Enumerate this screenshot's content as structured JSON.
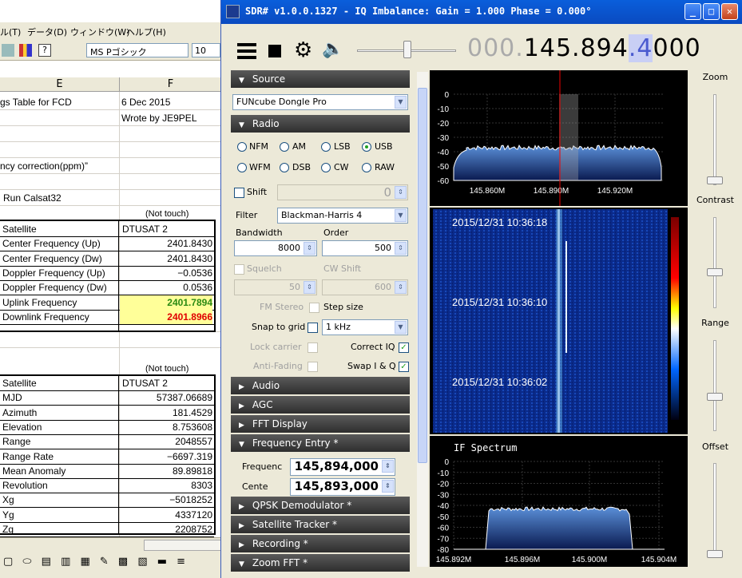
{
  "excel": {
    "menu": [
      "ル(T)",
      "データ(D)",
      "ウィンドウ(W)",
      "ヘルプ(H)"
    ],
    "font": "MS Pゴシック",
    "size": "10",
    "cols": [
      "E",
      "F"
    ],
    "r1": [
      "gs Table for FCD",
      "6 Dec 2015"
    ],
    "r2": "Wrote by JE9PEL",
    "r3": "ncy correction(ppm)”",
    "r4": "Run Calsat32",
    "nt1": "(Not touch)",
    "t1": [
      [
        "Satellite",
        "DTUSAT 2"
      ],
      [
        "Center Frequency (Up)",
        "2401.8430"
      ],
      [
        "Center Frequency (Dw)",
        "2401.8430"
      ],
      [
        "Doppler Frequency (Up)",
        "−0.0536"
      ],
      [
        "Doppler Frequency (Dw)",
        "0.0536"
      ],
      [
        "Uplink Frequency",
        "2401.7894"
      ],
      [
        "Downlink Frequency",
        "2401.8966"
      ]
    ],
    "nt2": "(Not touch)",
    "t2": [
      [
        "Satellite",
        "DTUSAT 2"
      ],
      [
        "MJD",
        "57387.06689"
      ],
      [
        "Azimuth",
        "181.4529"
      ],
      [
        "Elevation",
        "8.753608"
      ],
      [
        "Range",
        "2048557"
      ],
      [
        "Range Rate",
        "−6697.319"
      ],
      [
        "Mean Anomaly",
        "89.89818"
      ],
      [
        "Revolution",
        "8303"
      ],
      [
        "Xg",
        "−5018252"
      ],
      [
        "Yg",
        "4337120"
      ],
      [
        "Zg",
        "2208752"
      ]
    ]
  },
  "sdr": {
    "title": "SDR# v1.0.0.1327 - IQ Imbalance: Gain = 1.000 Phase = 0.000°",
    "freq_gray": "000.",
    "freq_main": "145.894",
    "freq_sel": ".4",
    "freq_end": "000",
    "source_hdr": "Source",
    "source_dev": "FUNcube Dongle Pro",
    "radio_hdr": "Radio",
    "modes": [
      "NFM",
      "AM",
      "LSB",
      "USB",
      "WFM",
      "DSB",
      "CW",
      "RAW"
    ],
    "shift": "Shift",
    "shift_val": "0",
    "filter_lbl": "Filter",
    "filter": "Blackman-Harris 4",
    "bw_lbl": "Bandwidth",
    "order_lbl": "Order",
    "bw": "8000",
    "order": "500",
    "squelch": "Squelch",
    "cwshift": "CW Shift",
    "sq_val": "50",
    "cw_val": "600",
    "fmstereo": "FM Stereo",
    "stepsize": "Step size",
    "snap": "Snap to grid",
    "step": "1 kHz",
    "lockc": "Lock carrier",
    "correctiq": "Correct IQ",
    "antifade": "Anti-Fading",
    "swapiq": "Swap I & Q",
    "audio": "Audio",
    "agc": "AGC",
    "fftdisp": "FFT Display",
    "freqentry": "Frequency Entry *",
    "fe_freq_lbl": "Frequenc",
    "fe_freq": "145,894,000",
    "fe_cent_lbl": "Cente",
    "fe_cent": "145,893,000",
    "qpsk": "QPSK Demodulator *",
    "sattrack": "Satellite Tracker *",
    "rec": "Recording *",
    "zoomfft": "Zoom FFT *",
    "zoom": "Zoom",
    "contrast": "Contrast",
    "range": "Range",
    "offset": "Offset",
    "if_title": "IF Spectrum",
    "ts": [
      "2015/12/31 10:36:18",
      "2015/12/31 10:36:10",
      "2015/12/31 10:36:02"
    ]
  },
  "chart_data": [
    {
      "type": "area",
      "title": "",
      "xlabel": "",
      "ylabel": "",
      "x_ticks": [
        "145.860M",
        "145.890M",
        "145.920M"
      ],
      "y_ticks": [
        "0",
        "-10",
        "-20",
        "-30",
        "-40",
        "-50",
        "-60"
      ],
      "ylim": [
        -60,
        0
      ]
    },
    {
      "type": "area",
      "title": "IF Spectrum",
      "xlabel": "",
      "ylabel": "",
      "x_ticks": [
        "145.892M",
        "145.896M",
        "145.900M",
        "145.904M"
      ],
      "y_ticks": [
        "0",
        "-10",
        "-20",
        "-30",
        "-40",
        "-50",
        "-60",
        "-70",
        "-80"
      ],
      "ylim": [
        -80,
        0
      ]
    }
  ]
}
